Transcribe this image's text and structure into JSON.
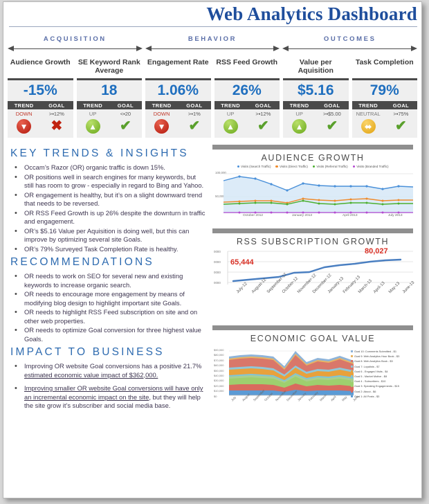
{
  "header": {
    "title": "Web Analytics Dashboard"
  },
  "categories": [
    {
      "label": "ACQUISITION"
    },
    {
      "label": "BEHAVIOR"
    },
    {
      "label": "OUTCOMES"
    }
  ],
  "kpi_headers": {
    "trend": "TREND",
    "goal": "GOAL"
  },
  "kpis": [
    {
      "title": "Audience Growth",
      "value": "-15%",
      "trend": "DOWN",
      "goal": ">▪12%",
      "trend_icon": "arrow-down-icon",
      "goal_icon": "cross-icon"
    },
    {
      "title": "SE Keyword Rank Average",
      "value": "18",
      "trend": "UP",
      "goal": "<▪20",
      "trend_icon": "arrow-up-icon",
      "goal_icon": "check-icon"
    },
    {
      "title": "Engagement Rate",
      "value": "1.06%",
      "trend": "DOWN",
      "goal": ">▪1%",
      "trend_icon": "arrow-down-icon",
      "goal_icon": "check-icon"
    },
    {
      "title": "RSS Feed Growth",
      "value": "26%",
      "trend": "UP",
      "goal": ">▪12%",
      "trend_icon": "arrow-up-icon",
      "goal_icon": "check-icon"
    },
    {
      "title": "Value per Aquisition",
      "value": "$5.16",
      "trend": "UP",
      "goal": ">▪$5.00",
      "trend_icon": "arrow-up-icon",
      "goal_icon": "check-icon"
    },
    {
      "title": "Task Completion",
      "value": "79%",
      "trend": "NEUTRAL",
      "goal": ">▪75%",
      "trend_icon": "arrow-leftright-icon",
      "goal_icon": "check-icon"
    }
  ],
  "sections": {
    "key_trends": {
      "heading": "KEY TRENDS & INSIGHTS",
      "bullets": [
        "Occam’s Razor (OR) organic traffic is down 15%.",
        "OR positions well in search engines for many keywords, but still has room to grow - especially in regard to Bing and Yahoo.",
        "OR engagement is healthy, but it’s on a slight downward trend that needs to be reversed.",
        "OR RSS Feed Growth is up 26% despite the downturn in traffic and engagement.",
        "OR’s $5.16 Value per Aquisition is doing well, but this can improve by optimizing several site Goals.",
        "OR’s 79% Surveyed Task Completion Rate is healthy."
      ]
    },
    "recommendations": {
      "heading": "RECOMMENDATIONS",
      "bullets": [
        "OR needs to work on SEO for several new and existing keywords to increase organic search.",
        "OR needs to encourage more engagement by means of modifying blog design to highlight important site Goals.",
        "OR needs to highlight RSS Feed subscription on site and on other web properties.",
        "OR needs to optimize Goal conversion for three highest value Goals."
      ]
    },
    "impact": {
      "heading": "IMPACT TO BUSINESS",
      "bullets": [
        {
          "plain": "Improving OR website Goal conversions has a positive 21.7% ",
          "underlined": "estimated economic value impact of $362,000."
        },
        {
          "underlined": "Improving smaller OR website Goal conversions will have only an incremental economic impact on the site",
          "plain_after": ", but they will help the site grow it’s subscriber and social media base."
        }
      ]
    }
  },
  "chart_data": [
    {
      "type": "line",
      "title": "AUDIENCE GROWTH",
      "legend_position": "top",
      "grid": true,
      "xlabel": "",
      "ylabel": "",
      "ylim": [
        0,
        100000
      ],
      "yticks": [
        "100,000",
        "50,000"
      ],
      "x": [
        "",
        "",
        "",
        "",
        "October 2012",
        "",
        "",
        "",
        "January 2013",
        "",
        "",
        "",
        "April 2013",
        "",
        "",
        "",
        "July 2013",
        ""
      ],
      "xtick_labels": [
        "October 2012",
        "January 2013",
        "April 2013",
        "July 2013"
      ],
      "series": [
        {
          "name": "Visits (Search Traffic)",
          "color": "#4a90d9",
          "values": [
            78000,
            86000,
            82000,
            72000,
            60000,
            72000,
            68000,
            66000,
            66000,
            66000,
            62000,
            66000,
            65000
          ]
        },
        {
          "name": "Visits (Direct Traffic)",
          "color": "#ef8b2c",
          "values": [
            30000,
            31000,
            33000,
            32000,
            28000,
            38000,
            34000,
            33000,
            36000,
            38000,
            32000,
            35000,
            34000
          ]
        },
        {
          "name": "Visits (Referral Traffic)",
          "color": "#4caf2f",
          "values": [
            26000,
            28000,
            30000,
            29000,
            26000,
            34000,
            27000,
            26000,
            28000,
            29000,
            25000,
            26000,
            26000
          ]
        },
        {
          "name": "Visits (Branded Traffic)",
          "color": "#b44ad0",
          "values": [
            1000,
            1000,
            1000,
            1000,
            1000,
            1000,
            1000,
            1000,
            1000,
            1000,
            1000,
            1000,
            1000
          ]
        }
      ]
    },
    {
      "type": "line",
      "title": "RSS SUBSCRIPTION GROWTH",
      "grid": true,
      "ylim": [
        60000,
        85000
      ],
      "yticks": [
        "0000",
        "0000",
        "0000",
        "0000"
      ],
      "categories": [
        "July-12",
        "August-12",
        "September-12",
        "October-12",
        "November-12",
        "December-12",
        "January-13",
        "February-13",
        "March-13",
        "April-13",
        "May-13",
        "June-13"
      ],
      "values": [
        65444,
        67000,
        68500,
        70000,
        72500,
        73200,
        75500,
        76500,
        77500,
        78800,
        79800,
        80027
      ],
      "annotations": [
        {
          "text": "65,444",
          "at": "start"
        },
        {
          "text": "80,027",
          "at": "end"
        }
      ],
      "line_color": "#4a7fc1"
    },
    {
      "type": "area",
      "title": "ECONOMIC GOAL VALUE",
      "stacked": true,
      "legend_position": "right",
      "ylim": [
        0,
        90000
      ],
      "yticks": [
        "$90,000",
        "$80,000",
        "$70,000",
        "$60,000",
        "$50,000",
        "$40,000",
        "$30,000",
        "$20,000",
        "$10,000",
        "$0"
      ],
      "categories": [
        "July",
        "August",
        "September",
        "October",
        "November",
        "December",
        "January",
        "February",
        "March",
        "April",
        "May",
        "June"
      ],
      "series": [
        {
          "name": "Goal 10: Comments Submitted - $1",
          "color": "#8fb4d9"
        },
        {
          "name": "Goal 9: Web Analytics Hour Book - $3",
          "color": "#e8b464"
        },
        {
          "name": "Goal 8: Web Analytics Book - $3",
          "color": "#d9776a"
        },
        {
          "name": "Goal 7: Loyalists - $7",
          "color": "#8fc7d9"
        },
        {
          "name": "Goal 6 - Engaged Visits - $4",
          "color": "#e8a13c"
        },
        {
          "name": "Goal 5 - Market Motive - $8",
          "color": "#7fc4d9"
        },
        {
          "name": "Goal 4 - Subscribers - $10",
          "color": "#a9cf8f"
        },
        {
          "name": "Goal 3: Speaking Engagements - $15",
          "color": "#9ecf6e"
        },
        {
          "name": "Goal 2: About - $6",
          "color": "#d96a5e"
        },
        {
          "name": "Goal 1: All Posts - $3",
          "color": "#5b9bd5"
        }
      ]
    }
  ]
}
